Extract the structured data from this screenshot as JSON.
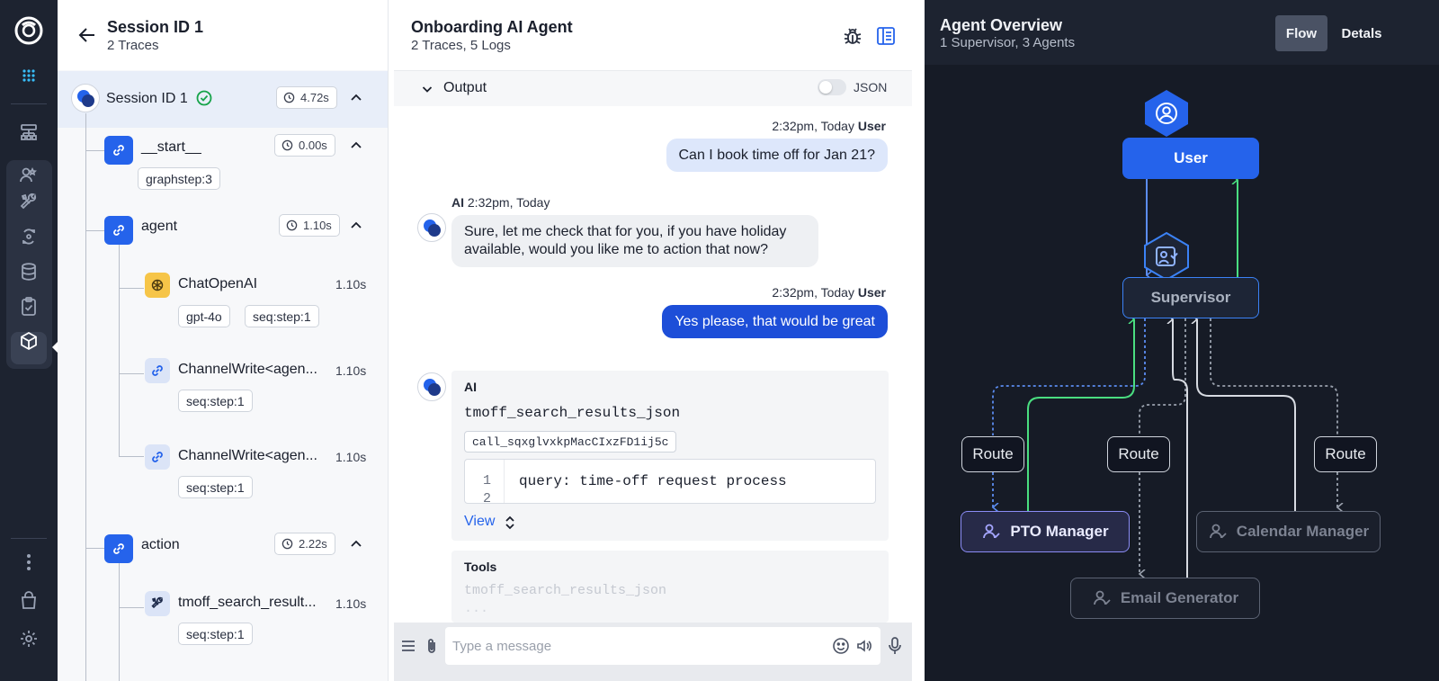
{
  "rail": {
    "icons": [
      "app-logo",
      "apps-grid-icon",
      "hierarchy-icon",
      "users-icon",
      "tools-icon",
      "integrations-icon",
      "database-icon",
      "clipboard-check-icon",
      "cube-icon",
      "more-icon",
      "shopping-bag-icon",
      "settings-icon"
    ]
  },
  "trace": {
    "title": "Session ID 1",
    "subtitle": "2 Traces",
    "session": {
      "label": "Session ID 1",
      "duration": "4.72s"
    },
    "nodes": [
      {
        "label": "__start__",
        "duration": "0.00s",
        "tags": [
          "graphstep:3"
        ]
      },
      {
        "label": "agent",
        "duration": "1.10s"
      },
      {
        "label": "ChatOpenAI",
        "time": "1.10s",
        "tags": [
          "gpt-4o",
          "seq:step:1"
        ]
      },
      {
        "label": "ChannelWrite<agen...",
        "time": "1.10s",
        "tags": [
          "seq:step:1"
        ]
      },
      {
        "label": "ChannelWrite<agen...",
        "time": "1.10s",
        "tags": [
          "seq:step:1"
        ]
      },
      {
        "label": "action",
        "duration": "2.22s"
      },
      {
        "label": "tmoff_search_result...",
        "time": "1.10s",
        "tags": [
          "seq:step:1"
        ]
      }
    ]
  },
  "chat": {
    "title": "Onboarding AI Agent",
    "subtitle": "2 Traces, 5 Logs",
    "output_label": "Output",
    "json_label": "JSON",
    "messages": [
      {
        "time": "2:32pm, Today",
        "who": "User",
        "text": "Can I book time off for Jan 21?"
      },
      {
        "who": "AI",
        "time": "2:32pm, Today",
        "text": "Sure, let me check that for you, if you have holiday available, would you like me to action that now?"
      },
      {
        "time": "2:32pm, Today",
        "who": "User",
        "text": "Yes please, that would be great"
      }
    ],
    "tool_call": {
      "who": "AI",
      "function": "tmoff_search_results_json",
      "call_id": "call_sqxglvxkpMacCIxzFD1ij5c",
      "line1": "1",
      "line2": "2",
      "code": "query: time-off request process",
      "view_label": "View"
    },
    "tools": {
      "label": "Tools",
      "faded1": "tmoff_search_results_json",
      "faded2": "..."
    },
    "input": {
      "placeholder": "Type a message"
    }
  },
  "flow": {
    "title": "Agent Overview",
    "subtitle": "1 Supervisor, 3 Agents",
    "tabs": [
      "Flow",
      "Detals"
    ],
    "active_tab": "Flow",
    "nodes": {
      "user": "User",
      "supervisor": "Supervisor",
      "route_left": "Route",
      "route_mid": "Route",
      "route_right": "Route",
      "pto": "PTO Manager",
      "calendar": "Calendar Manager",
      "email": "Email Generator"
    },
    "colors": {
      "user": "#2563eb",
      "supervisor_border": "#3b82f6",
      "return_edge": "#4ade80",
      "pto_border": "#8b8cf5"
    }
  }
}
